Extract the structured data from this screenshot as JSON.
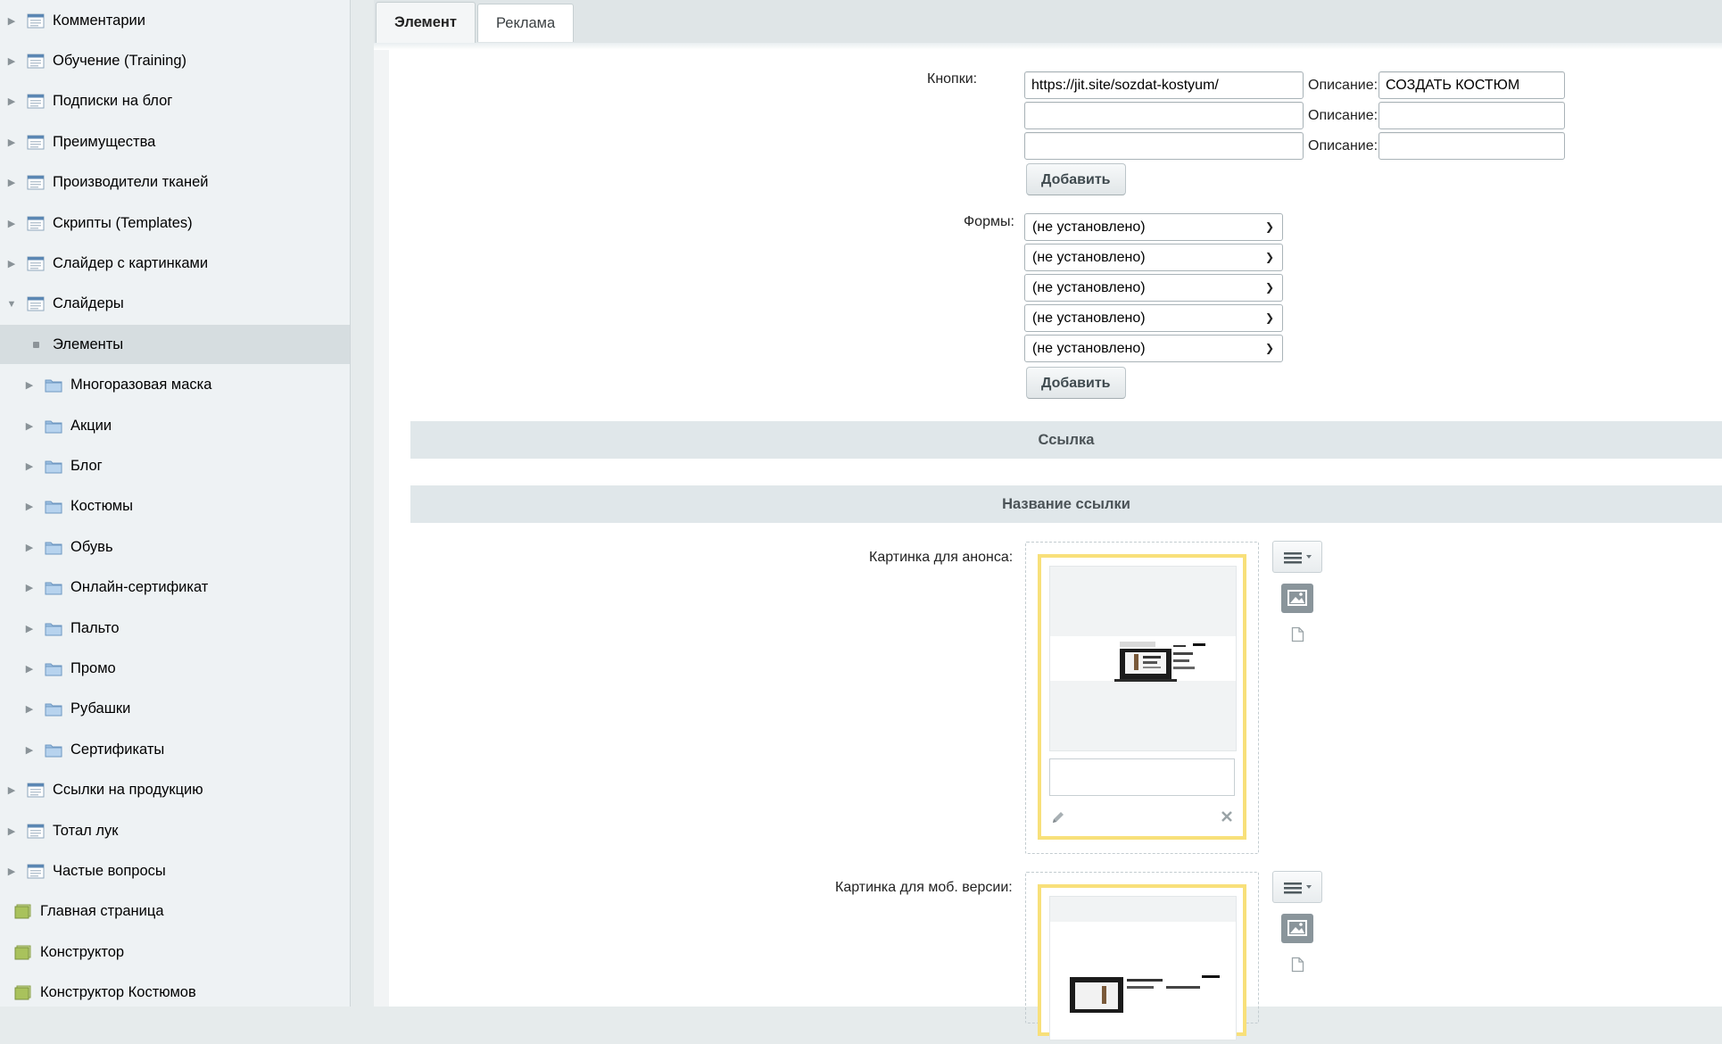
{
  "sidebar": {
    "items": [
      {
        "label": "Комментарии",
        "icon": "list-icon",
        "arrow": "right",
        "level": 1
      },
      {
        "label": "Обучение (Training)",
        "icon": "list-icon",
        "arrow": "right",
        "level": 1
      },
      {
        "label": "Подписки на блог",
        "icon": "list-icon",
        "arrow": "right",
        "level": 1
      },
      {
        "label": "Преимущества",
        "icon": "list-icon",
        "arrow": "right",
        "level": 1
      },
      {
        "label": "Производители тканей",
        "icon": "list-icon",
        "arrow": "right",
        "level": 1
      },
      {
        "label": "Скрипты (Templates)",
        "icon": "list-icon",
        "arrow": "right",
        "level": 1
      },
      {
        "label": "Слайдер с картинками",
        "icon": "list-icon",
        "arrow": "right",
        "level": 1
      },
      {
        "label": "Слайдеры",
        "icon": "list-icon",
        "arrow": "down",
        "level": 1
      },
      {
        "label": "Элементы",
        "icon": "bullet",
        "arrow": "none",
        "level": 1,
        "active": true
      },
      {
        "label": "Многоразовая маска",
        "icon": "folder-icon",
        "arrow": "right",
        "level": 2
      },
      {
        "label": "Акции",
        "icon": "folder-icon",
        "arrow": "right",
        "level": 2
      },
      {
        "label": "Блог",
        "icon": "folder-icon",
        "arrow": "right",
        "level": 2
      },
      {
        "label": "Костюмы",
        "icon": "folder-icon",
        "arrow": "right",
        "level": 2
      },
      {
        "label": "Обувь",
        "icon": "folder-icon",
        "arrow": "right",
        "level": 2
      },
      {
        "label": "Онлайн-сертификат",
        "icon": "folder-icon",
        "arrow": "right",
        "level": 2
      },
      {
        "label": "Пальто",
        "icon": "folder-icon",
        "arrow": "right",
        "level": 2
      },
      {
        "label": "Промо",
        "icon": "folder-icon",
        "arrow": "right",
        "level": 2
      },
      {
        "label": "Рубашки",
        "icon": "folder-icon",
        "arrow": "right",
        "level": 2
      },
      {
        "label": "Сертификаты",
        "icon": "folder-icon",
        "arrow": "right",
        "level": 2
      },
      {
        "label": "Ссылки на продукцию",
        "icon": "list-icon",
        "arrow": "right",
        "level": 1
      },
      {
        "label": "Тотал лук",
        "icon": "list-icon",
        "arrow": "right",
        "level": 1
      },
      {
        "label": "Частые вопросы",
        "icon": "list-icon",
        "arrow": "right",
        "level": 1
      },
      {
        "label": "Главная страница",
        "icon": "stack-icon",
        "arrow": "none",
        "level": 0
      },
      {
        "label": "Конструктор",
        "icon": "stack-icon",
        "arrow": "none",
        "level": 0
      },
      {
        "label": "Конструктор Костюмов",
        "icon": "stack-icon",
        "arrow": "none",
        "level": 0
      }
    ]
  },
  "tabs": [
    {
      "label": "Элемент",
      "active": true
    },
    {
      "label": "Реклама",
      "active": false
    }
  ],
  "buttons_field": {
    "label": "Кнопки:",
    "rows": [
      {
        "url": "https://jit.site/sozdat-kostyum/",
        "desc_label": "Описание:",
        "desc": "СОЗДАТЬ КОСТЮМ"
      },
      {
        "url": "",
        "desc_label": "Описание:",
        "desc": ""
      },
      {
        "url": "",
        "desc_label": "Описание:",
        "desc": ""
      }
    ],
    "add_label": "Добавить"
  },
  "forms_field": {
    "label": "Формы:",
    "selects": [
      "(не установлено)",
      "(не установлено)",
      "(не установлено)",
      "(не установлено)",
      "(не установлено)"
    ],
    "add_label": "Добавить"
  },
  "sections": {
    "link": "Ссылка",
    "link_name": "Название ссылки"
  },
  "images": {
    "announce_label": "Картинка для анонса:",
    "mobile_label": "Картинка для моб. версии:"
  },
  "colors": {
    "card_border": "#f8e07a",
    "section_band": "#e0e7ea",
    "sidebar_bg": "#eef2f4"
  }
}
